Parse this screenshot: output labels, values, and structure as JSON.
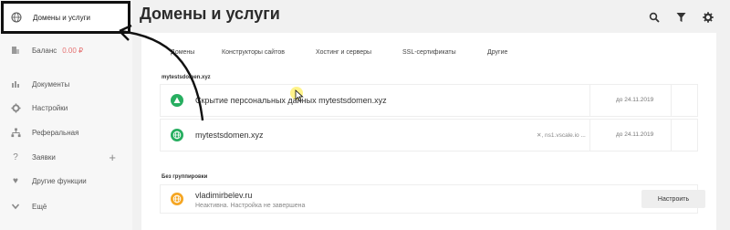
{
  "sidebar": {
    "items": [
      {
        "label": "Домены и услуги",
        "icon": "globe-icon"
      },
      {
        "label": "Баланс",
        "value": "0.00 ₽",
        "icon": "building-icon"
      },
      {
        "label": "Документы",
        "icon": "documents-icon"
      },
      {
        "label": "Настройки",
        "icon": "gear-icon"
      },
      {
        "label": "Реферальная",
        "icon": "referral-icon"
      },
      {
        "label": "Заявки",
        "icon": "question-icon"
      },
      {
        "label": "Другие функции",
        "icon": "heart-icon"
      },
      {
        "label": "Ещё",
        "icon": "chevron-down-icon"
      }
    ]
  },
  "header": {
    "title": "Домены и услуги",
    "icons": [
      "search-icon",
      "filter-icon",
      "gear-icon"
    ]
  },
  "tabs": [
    "Домены",
    "Конструкторы сайтов",
    "Хостинг и серверы",
    "SSL-сертификаты",
    "Другие"
  ],
  "groups": [
    {
      "title": "mytestsdomen.xyz",
      "rows": [
        {
          "name": "Скрытие персональных данных mytestsdomen.xyz",
          "date": "до 24.11.2019",
          "icon": "shield-triangle-icon",
          "color": "#27ae60"
        },
        {
          "name": "mytestsdomen.xyz",
          "ns": "✕, ns1.vscale.io ...",
          "date": "до 24.11.2019",
          "icon": "globe-icon",
          "color": "#27ae60"
        }
      ]
    },
    {
      "title": "Без группировки",
      "rows": [
        {
          "name": "vladimirbelev.ru",
          "sub": "Неактивна. Настройка не завершена",
          "button": "Настроить",
          "icon": "globe-icon",
          "color": "#f5a623"
        }
      ]
    }
  ],
  "colors": {
    "accent_green": "#27ae60",
    "accent_orange": "#f5a623",
    "balance_red": "#e57373"
  }
}
